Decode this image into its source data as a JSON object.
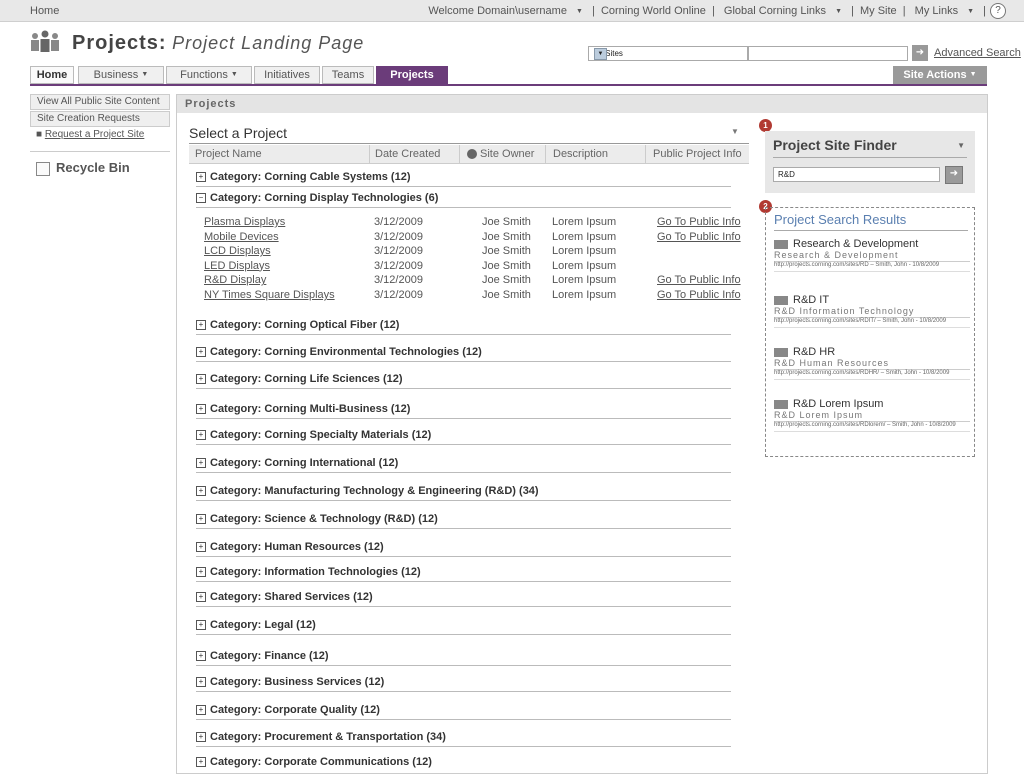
{
  "topbar": {
    "home": "Home",
    "welcome": "Welcome Domain\\username",
    "links": [
      "Corning World Online",
      "Global Corning Links",
      "My Site",
      "My Links"
    ],
    "help": "?"
  },
  "header": {
    "title_bold": "Projects:",
    "title_italic": "Project Landing Page",
    "site_select": "All Sites",
    "advanced_search": "Advanced Search"
  },
  "nav": {
    "tabs": [
      "Home",
      "Business",
      "Functions",
      "Initiatives",
      "Teams",
      "Projects"
    ],
    "site_actions": "Site Actions"
  },
  "left": {
    "items": [
      "View All Public Site Content",
      "Site Creation Requests"
    ],
    "request": "Request a Project Site",
    "recycle": "Recycle Bin"
  },
  "main": {
    "header": "Projects",
    "select_title": "Select a Project",
    "columns": [
      "Project Name",
      "Date Created",
      "Site Owner",
      "Description",
      "Public Project Info"
    ],
    "expanded_category": "Category: Corning Display Technologies (6)",
    "first_category": "Category: Corning Cable Systems (12)",
    "projects": [
      {
        "name": "Plasma Displays",
        "date": "3/12/2009",
        "owner": "Joe Smith",
        "desc": "Lorem Ipsum",
        "info": "Go To Public Info"
      },
      {
        "name": "Mobile Devices",
        "date": "3/12/2009",
        "owner": "Joe Smith",
        "desc": "Lorem Ipsum",
        "info": "Go To Public Info"
      },
      {
        "name": "LCD Displays",
        "date": "3/12/2009",
        "owner": "Joe Smith",
        "desc": "Lorem Ipsum",
        "info": ""
      },
      {
        "name": "LED Displays",
        "date": "3/12/2009",
        "owner": "Joe Smith",
        "desc": "Lorem Ipsum",
        "info": ""
      },
      {
        "name": "R&D Display",
        "date": "3/12/2009",
        "owner": "Joe Smith",
        "desc": "Lorem Ipsum",
        "info": "Go To Public Info"
      },
      {
        "name": "NY Times Square Displays",
        "date": "3/12/2009",
        "owner": "Joe Smith",
        "desc": "Lorem Ipsum",
        "info": "Go To Public Info"
      }
    ],
    "categories": [
      "Category: Corning Optical Fiber (12)",
      "Category: Corning Environmental Technologies  (12)",
      "Category: Corning Life Sciences  (12)",
      "Category: Corning Multi-Business  (12)",
      "Category: Corning Specialty Materials  (12)",
      "Category: Corning International  (12)",
      "Category: Manufacturing Technology &  Engineering (R&D)  (34)",
      "Category: Science & Technology (R&D)  (12)",
      "Category: Human Resources  (12)",
      "Category: Information Technologies (12)",
      "Category: Shared Services  (12)",
      "Category: Legal  (12)",
      "Category: Finance  (12)",
      "Category: Business Services  (12)",
      "Category: Corporate Quality  (12)",
      "Category: Procurement & Transportation (34)",
      "Category: Corporate Communications  (12)"
    ]
  },
  "finder": {
    "badge": "1",
    "title": "Project Site Finder",
    "query": "R&D"
  },
  "results": {
    "badge": "2",
    "title": "Project Search Results",
    "items": [
      {
        "name": "Research & Development",
        "sub": "Research & Development",
        "url": "http://projects.corning.com/sites/RD – Smith, John - 10/8/2009"
      },
      {
        "name": "R&D IT",
        "sub": "R&D Information Technology",
        "url": "http://projects.corning.com/sites/RDIT/ – Smith, John - 10/8/2009"
      },
      {
        "name": "R&D HR",
        "sub": "R&D Human Resources",
        "url": "http://projects.corning.com/sites/RDHR/ – Smith, John - 10/8/2009"
      },
      {
        "name": "R&D Lorem Ipsum",
        "sub": "R&D Lorem Ipsum",
        "url": "http://projects.corning.com/sites/RDlorem/ – Smith, John - 10/8/2009"
      }
    ]
  }
}
